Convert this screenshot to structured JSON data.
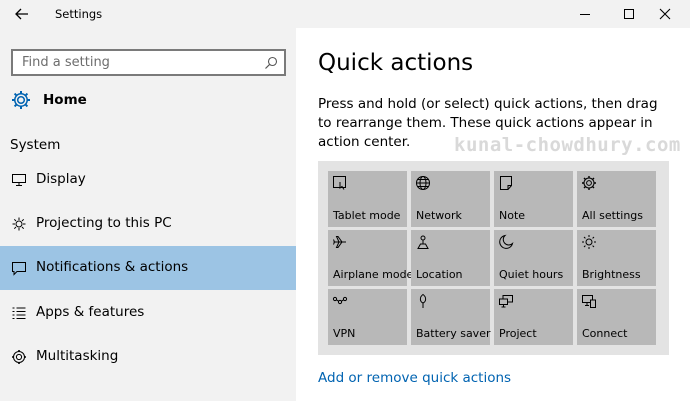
{
  "window": {
    "title": "Settings",
    "back_icon": "back-arrow-icon",
    "controls": [
      "minimize-icon",
      "maximize-icon",
      "close-icon"
    ]
  },
  "sidebar": {
    "search_placeholder": "Find a setting",
    "search_icon": "search-icon",
    "home_label": "Home",
    "section_label": "System",
    "items": [
      {
        "label": "Display",
        "icon": "display-icon"
      },
      {
        "label": "Projecting to this PC",
        "icon": "projecting-icon"
      },
      {
        "label": "Notifications & actions",
        "icon": "notifications-icon",
        "selected": true
      },
      {
        "label": "Apps & features",
        "icon": "apps-list-icon"
      },
      {
        "label": "Multitasking",
        "icon": "multitasking-icon"
      }
    ]
  },
  "main": {
    "heading": "Quick actions",
    "description": "Press and hold (or select) quick actions, then drag to rearrange them. These quick actions appear in action center.",
    "watermark": "kunal-chowdhury.com",
    "tiles": [
      {
        "label": "Tablet mode",
        "icon": "tablet-mode-icon"
      },
      {
        "label": "Network",
        "icon": "network-globe-icon"
      },
      {
        "label": "Note",
        "icon": "note-icon"
      },
      {
        "label": "All settings",
        "icon": "settings-gear-icon"
      },
      {
        "label": "Airplane mode",
        "icon": "airplane-icon"
      },
      {
        "label": "Location",
        "icon": "location-icon"
      },
      {
        "label": "Quiet hours",
        "icon": "moon-icon"
      },
      {
        "label": "Brightness",
        "icon": "brightness-sun-icon"
      },
      {
        "label": "VPN",
        "icon": "vpn-icon"
      },
      {
        "label": "Battery saver",
        "icon": "battery-saver-icon"
      },
      {
        "label": "Project",
        "icon": "project-icon"
      },
      {
        "label": "Connect",
        "icon": "connect-icon"
      }
    ],
    "link": "Add or remove quick actions"
  },
  "colors": {
    "sidebar_bg": "#f2f2f2",
    "selected_bg": "#9cc4e4",
    "tile_bg": "#b8b8b8",
    "grid_bg": "#e3e3e3",
    "link": "#0063b1"
  }
}
